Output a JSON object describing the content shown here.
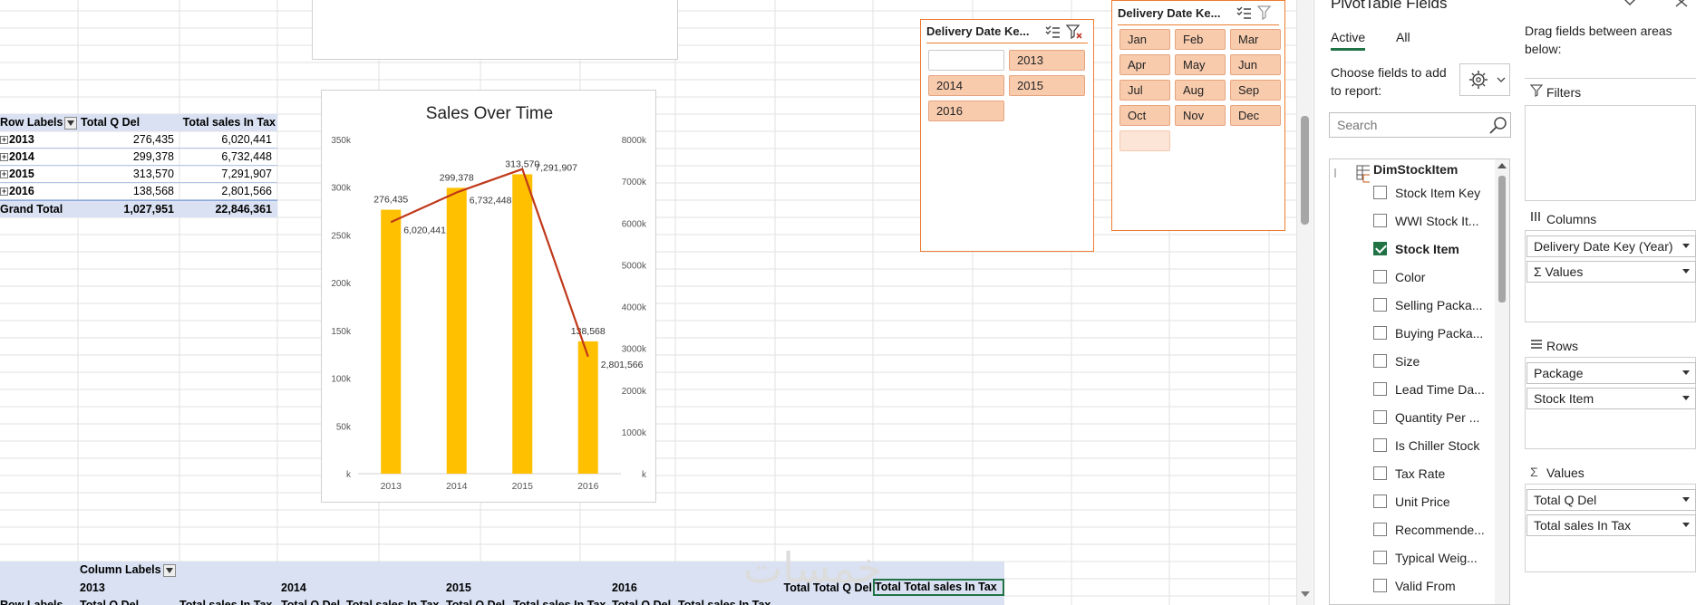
{
  "pivot_table_1": {
    "headers": [
      "Row Labels",
      "Total Q Del",
      "Total sales In Tax"
    ],
    "rows": [
      {
        "label": "2013",
        "qty": "276,435",
        "sales": "6,020,441"
      },
      {
        "label": "2014",
        "qty": "299,378",
        "sales": "6,732,448"
      },
      {
        "label": "2015",
        "qty": "313,570",
        "sales": "7,291,907"
      },
      {
        "label": "2016",
        "qty": "138,568",
        "sales": "2,801,566"
      }
    ],
    "grand_total": {
      "label": "Grand Total",
      "qty": "1,027,951",
      "sales": "22,846,361"
    }
  },
  "pivot_table_2": {
    "column_labels": "Column Labels",
    "years": [
      "2013",
      "2014",
      "2015",
      "2016"
    ],
    "total_q": "Total Total Q Del",
    "total_sales": "Total Total sales In Tax",
    "sub_row": [
      "Row Labels",
      "Total Q Del",
      "Total sales In Tax",
      "Total Q Del",
      "Total sales In Tax",
      "Total Q Del",
      "Total sales In Tax",
      "Total Q Del",
      "Total sales In Tax"
    ]
  },
  "chart_data": {
    "type": "bar",
    "title": "Sales Over Time",
    "categories": [
      "2013",
      "2014",
      "2015",
      "2016"
    ],
    "series": [
      {
        "name": "Total Q Del",
        "type": "bar",
        "axis": "left",
        "color": "#ffc000",
        "values": [
          276435,
          299378,
          313570,
          138568
        ],
        "labels": [
          "276,435",
          "299,378",
          "313,570",
          "138,568"
        ]
      },
      {
        "name": "Total sales In Tax",
        "type": "line",
        "axis": "right",
        "color": "#c0381a",
        "values": [
          6020441,
          6732448,
          7291907,
          2801566
        ],
        "labels": [
          "6,020,441",
          "6,732,448",
          "7,291,907",
          "2,801,566"
        ]
      }
    ],
    "y_left_ticks": [
      "k",
      "50k",
      "100k",
      "150k",
      "200k",
      "250k",
      "300k",
      "350k"
    ],
    "y_left_lim": [
      0,
      350000
    ],
    "y_right_ticks": [
      "k",
      "1000k",
      "2000k",
      "3000k",
      "4000k",
      "5000k",
      "6000k",
      "7000k",
      "8000k"
    ],
    "y_right_lim": [
      0,
      8000000
    ],
    "grid": false,
    "legend": "none"
  },
  "slicer_year": {
    "title": "Delivery Date Ke...",
    "items": [
      "",
      "2013",
      "2014",
      "2015",
      "2016"
    ]
  },
  "slicer_month": {
    "title": "Delivery Date Ke...",
    "items": [
      "Jan",
      "Feb",
      "Mar",
      "Apr",
      "May",
      "Jun",
      "Jul",
      "Aug",
      "Sep",
      "Oct",
      "Nov",
      "Dec",
      ""
    ]
  },
  "field_pane": {
    "title": "PivotTable Fields",
    "tabs": [
      "Active",
      "All"
    ],
    "choose_text": "Choose fields to add to report:",
    "search_placeholder": "Search",
    "drag_text": "Drag fields between areas below:",
    "table_name": "DimStockItem",
    "fields": [
      {
        "label": "Stock Item Key",
        "checked": false
      },
      {
        "label": "WWI Stock It...",
        "checked": false
      },
      {
        "label": "Stock Item",
        "checked": true
      },
      {
        "label": "Color",
        "checked": false
      },
      {
        "label": "Selling Packa...",
        "checked": false
      },
      {
        "label": "Buying Packa...",
        "checked": false
      },
      {
        "label": "Size",
        "checked": false
      },
      {
        "label": "Lead Time Da...",
        "checked": false
      },
      {
        "label": "Quantity Per ...",
        "checked": false
      },
      {
        "label": "Is Chiller Stock",
        "checked": false
      },
      {
        "label": "Tax Rate",
        "checked": false
      },
      {
        "label": "Unit Price",
        "checked": false
      },
      {
        "label": "Recommende...",
        "checked": false
      },
      {
        "label": "Typical Weig...",
        "checked": false
      },
      {
        "label": "Valid From",
        "checked": false
      }
    ],
    "areas": {
      "filters": {
        "title": "Filters",
        "items": []
      },
      "columns": {
        "title": "Columns",
        "items": [
          "Delivery Date Key (Year)",
          "Values"
        ]
      },
      "rows": {
        "title": "Rows",
        "items": [
          "Package",
          "Stock Item"
        ]
      },
      "values": {
        "title": "Values",
        "items": [
          "Total Q Del",
          "Total sales In Tax"
        ]
      }
    }
  },
  "watermark": "خمسات"
}
